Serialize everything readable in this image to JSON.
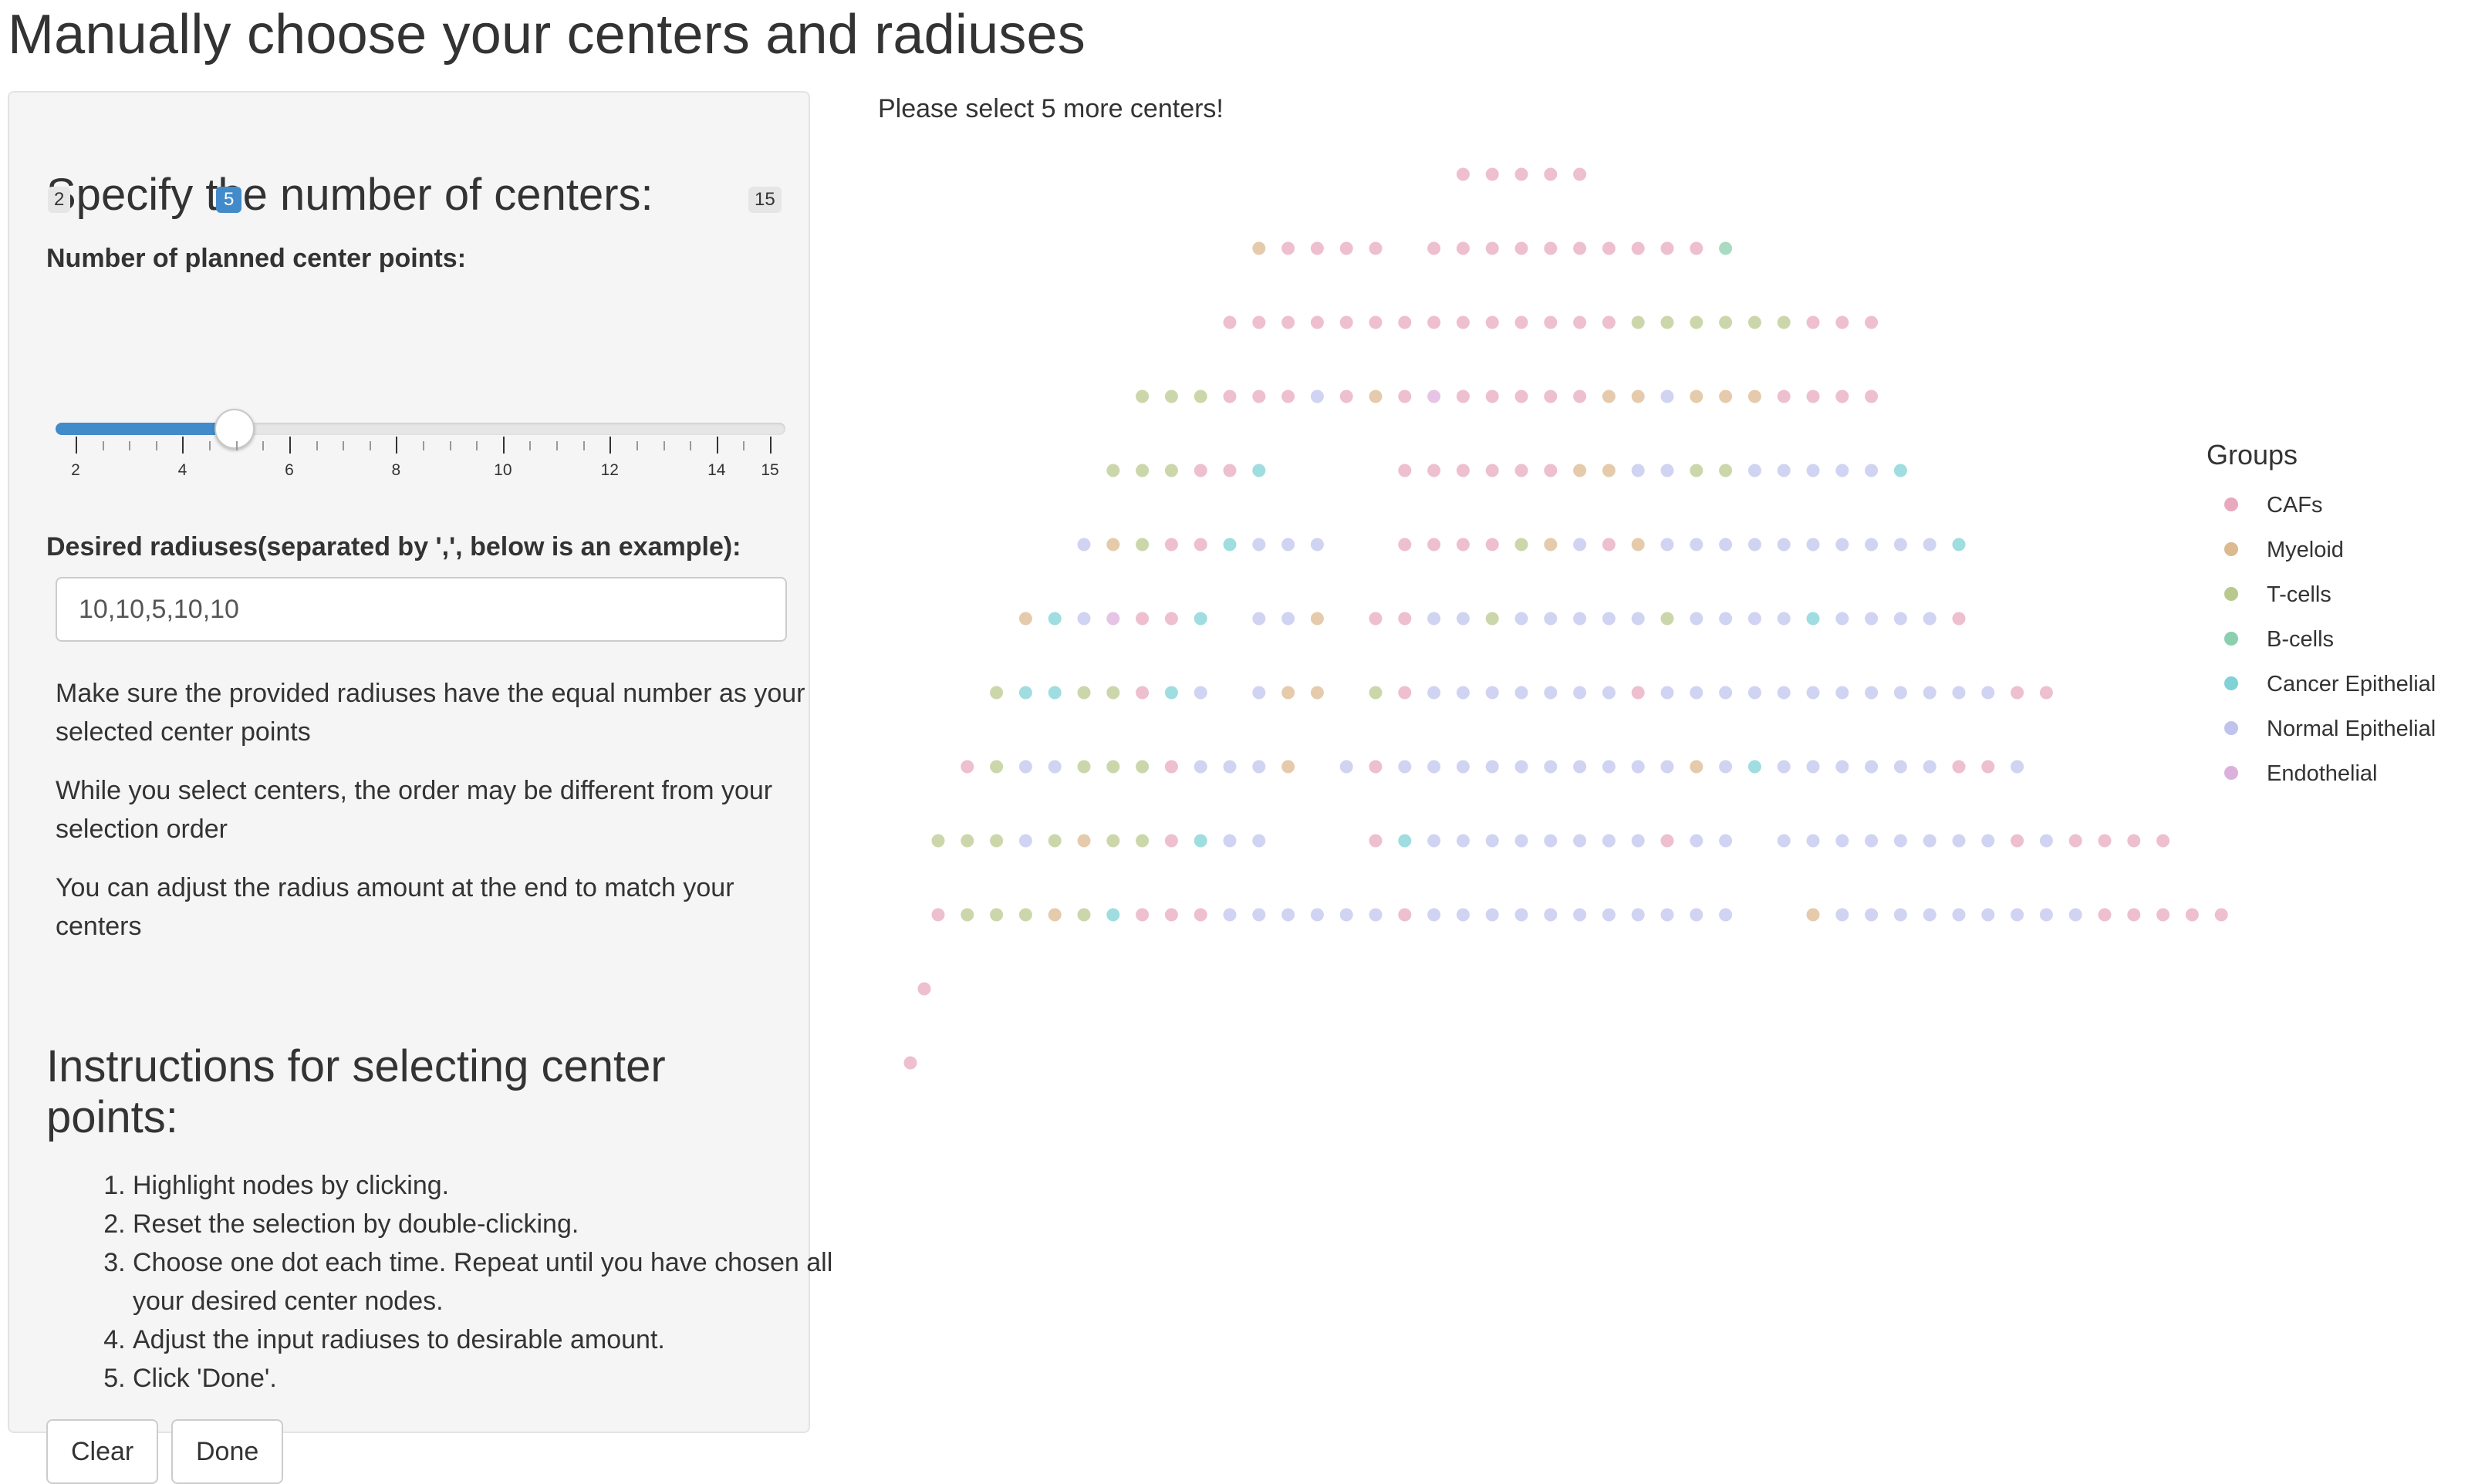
{
  "page": {
    "title": "Manually choose your centers and radiuses"
  },
  "sidebar": {
    "centers_heading": "Specify the number of centers:",
    "slider": {
      "label": "Number of planned center points:",
      "min": 2,
      "max": 15,
      "value": 5,
      "min_label": "2",
      "max_label": "15",
      "value_label": "5",
      "tick_labels": [
        "2",
        "4",
        "6",
        "8",
        "10",
        "12",
        "14",
        "15"
      ]
    },
    "radius_label": "Desired radiuses(separated by ',', below is an example):",
    "radius_value": "10,10,5,10,10",
    "help_1": "Make sure the provided radiuses have the equal number as your selected center points",
    "help_2": "While you select centers, the order may be different from your selection order",
    "help_3": "You can adjust the radius amount at the end to match your centers",
    "instructions_heading": "Instructions for selecting center points:",
    "steps": [
      "Highlight nodes by clicking.",
      "Reset the selection by double-clicking.",
      "Choose one dot each time. Repeat until you have chosen all your desired center nodes.",
      "Adjust the input radiuses to desirable amount.",
      "Click 'Done'."
    ],
    "clear_button": "Clear",
    "done_button": "Done"
  },
  "main": {
    "status": "Please select 5 more centers!"
  },
  "legend": {
    "title": "Groups",
    "items": [
      {
        "label": "CAFs",
        "color": "#e8a9be"
      },
      {
        "label": "Myeloid",
        "color": "#dcb98f"
      },
      {
        "label": "T-cells",
        "color": "#b9c98e"
      },
      {
        "label": "B-cells",
        "color": "#8ccfae"
      },
      {
        "label": "Cancer Epithelial",
        "color": "#7fd2d6"
      },
      {
        "label": "Normal Epithelial",
        "color": "#c0c4ec"
      },
      {
        "label": "Endothelial",
        "color": "#dcb0dd"
      }
    ]
  },
  "chart_data": {
    "type": "scatter",
    "groups": [
      "CAFs",
      "Myeloid",
      "T-cells",
      "B-cells",
      "Cancer Epithelial",
      "Normal Epithelial",
      "Endothelial"
    ],
    "rows": [
      {
        "row": 1,
        "segments": [
          {
            "start": 18,
            "codes": "CCCCC"
          }
        ]
      },
      {
        "row": 2,
        "segments": [
          {
            "start": 11,
            "codes": "MCCCC"
          },
          {
            "start": 17,
            "codes": "CCCCCCCCCCB"
          }
        ]
      },
      {
        "row": 3,
        "segments": [
          {
            "start": 10,
            "codes": "CCCCCCCCCCCCCCTTTTTTCCC"
          }
        ]
      },
      {
        "row": 4,
        "segments": [
          {
            "start": 7,
            "codes": "TTTCCCNCMCECCCCCMMNMMMCCCC"
          }
        ]
      },
      {
        "row": 5,
        "segments": [
          {
            "start": 6,
            "codes": "TTTCCP"
          },
          {
            "start": 16,
            "codes": "CCCCCCMMNNTTNNNNNP"
          }
        ]
      },
      {
        "row": 6,
        "segments": [
          {
            "start": 5,
            "codes": "NMTCCPNNN"
          },
          {
            "start": 16,
            "codes": "CCCCTMNCMNNNNNNNNNNP"
          }
        ]
      },
      {
        "row": 7,
        "segments": [
          {
            "start": 3,
            "codes": "MPNECCP"
          },
          {
            "start": 11,
            "codes": "NNM"
          },
          {
            "start": 15,
            "codes": "CCNNTNNNNNTNNNNPNNNNC"
          }
        ]
      },
      {
        "row": 8,
        "segments": [
          {
            "start": 2,
            "codes": "TPPTTCPN"
          },
          {
            "start": 11,
            "codes": "NMM"
          },
          {
            "start": 15,
            "codes": "TCNNNNNNNCNNNNNNNNNNNNCC"
          }
        ]
      },
      {
        "row": 9,
        "segments": [
          {
            "start": 1,
            "codes": "CTNNTTTCNNNM"
          },
          {
            "start": 14,
            "codes": "NCNNNNNNNNNNMNPNNNNNNCCN"
          }
        ]
      },
      {
        "row": 10,
        "segments": [
          {
            "start": 0,
            "codes": "TTTNTMTTCPNN"
          },
          {
            "start": 15,
            "codes": "CPNNNNNNNNCNN"
          },
          {
            "start": 29,
            "codes": "NNNNNNNNCNCCCC"
          }
        ]
      },
      {
        "row": 11,
        "segments": [
          {
            "start": 0,
            "codes": "CTTTMTPCCCNNNNNNCNNNNNNNNNNN"
          },
          {
            "start": 30,
            "codes": "MNNNNNNNNNCCCCC"
          }
        ]
      },
      {
        "row": 12,
        "segments": [
          {
            "start": 0,
            "codes": "C"
          }
        ]
      },
      {
        "row": 13,
        "segments": [
          {
            "start": 0,
            "codes": "C"
          }
        ]
      }
    ]
  }
}
